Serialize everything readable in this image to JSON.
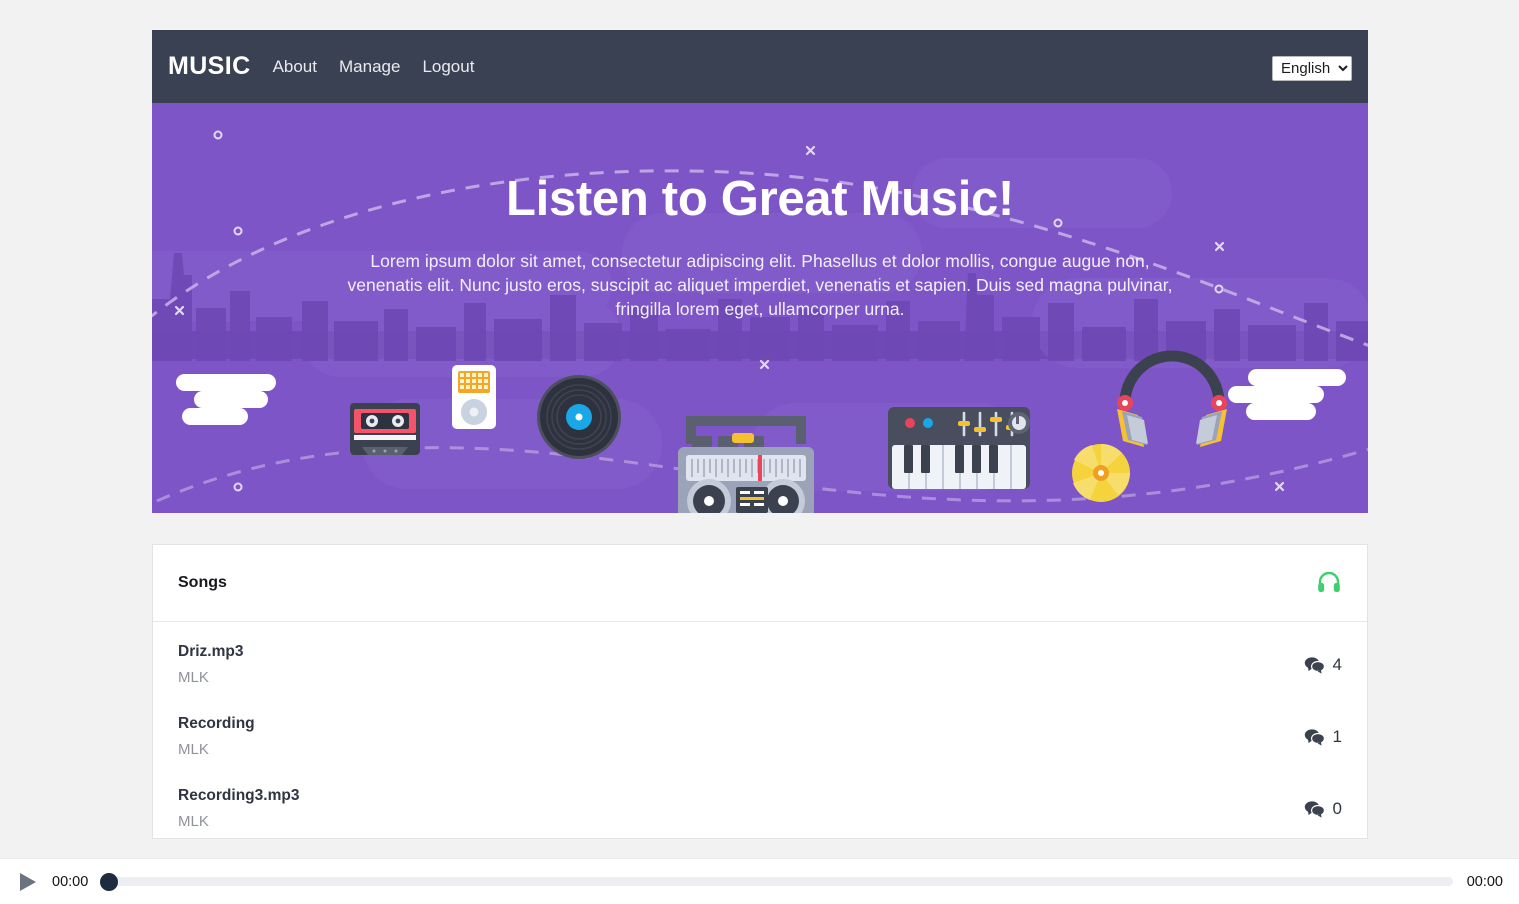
{
  "navbar": {
    "brand": "MUSIC",
    "links": [
      {
        "label": "About"
      },
      {
        "label": "Manage"
      },
      {
        "label": "Logout"
      }
    ],
    "language": {
      "selected": "English",
      "options": [
        "English"
      ]
    }
  },
  "hero": {
    "title": "Listen to Great Music!",
    "subtitle": "Lorem ipsum dolor sit amet, consectetur adipiscing elit. Phasellus et dolor mollis, congue augue non, venenatis elit. Nunc justo eros, suscipit ac aliquet imperdiet, venenatis et sapien. Duis sed magna pulvinar, fringilla lorem eget, ullamcorper urna.",
    "background_color": "#7d55c7"
  },
  "songs_card": {
    "title": "Songs",
    "header_icon": "headphones-icon",
    "header_icon_color": "#3ecf6e",
    "rows": [
      {
        "name": "Driz.mp3",
        "artist": "MLK",
        "comments": "4"
      },
      {
        "name": "Recording",
        "artist": "MLK",
        "comments": "1"
      },
      {
        "name": "Recording3.mp3",
        "artist": "MLK",
        "comments": "0"
      }
    ]
  },
  "player": {
    "play_icon": "play-icon",
    "current_time": "00:00",
    "duration": "00:00",
    "progress_percent": 0
  }
}
